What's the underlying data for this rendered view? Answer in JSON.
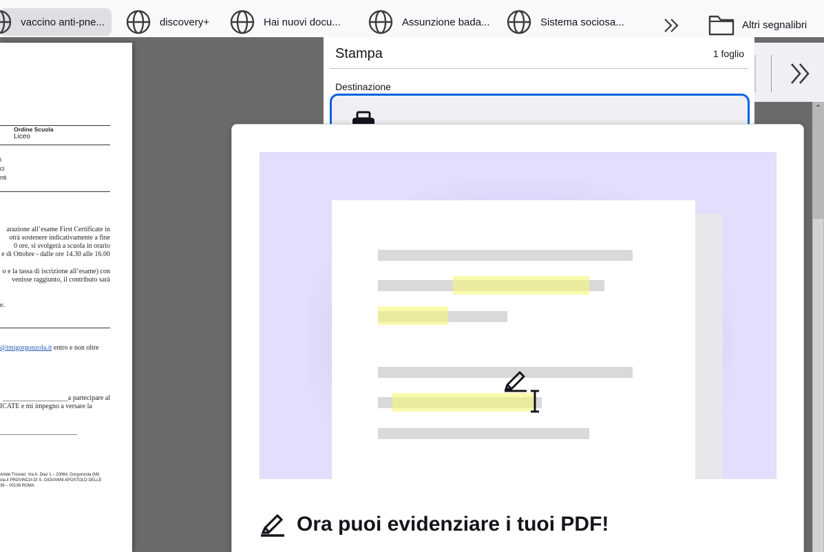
{
  "bookmarks": {
    "items": [
      {
        "label": "vaccino anti-pne...",
        "icon": "globe-icon"
      },
      {
        "label": "discovery+",
        "icon": "globe-icon"
      },
      {
        "label": "Hai nuovi docu...",
        "icon": "globe-icon"
      },
      {
        "label": "Assunzione bada...",
        "icon": "globe-icon"
      },
      {
        "label": "Sistema sociosa...",
        "icon": "globe-icon"
      }
    ],
    "overflow_icon": "chevron-double-right-icon",
    "other_label": "Altri segnalibri"
  },
  "pdf": {
    "ordine_label": "Ordine Scuola",
    "ordine_value": "Liceo",
    "lines_a": [
      "i",
      "ci",
      "nti"
    ],
    "para1": [
      "arazione all’esame First Certificate in",
      "otrà sostenere indicativamente a fine",
      "0 ore, si svolgerà a scuola in orario",
      "e di Ottobre - dalle ore 14.30 alle 16.00"
    ],
    "para2": [
      "o e la tassa di iscrizione all’esame) con",
      "venisse raggiunto, il contributo sarà"
    ],
    "para3": "e.",
    "email_link": "@imigorgonzola.it",
    "email_after": " entro e non oltre",
    "form1": "___________________a partecipare al",
    "form2": "ICATE e mi impegno a versare la",
    "form3": "________________________",
    "footer": [
      "Arilde Trouvet, Via A. Diaz 1 – 20064, Gorgonzola (MI)",
      "ola.it PROVINCIA DI S. GIOVANNI APOSTOLO DELLE",
      "36 – 00136 ROMA"
    ]
  },
  "print": {
    "title": "Stampa",
    "sheets": "1 foglio",
    "destination_label": "Destinazione",
    "printer_icon": "printer-icon"
  },
  "toolbar": {
    "overflow_icon": "chevron-double-right-icon"
  },
  "callout": {
    "title": "Ora puoi evidenziare i tuoi PDF!",
    "icon": "highlighter-icon",
    "illus_bg": "#e2defc",
    "highlight_color": "#f6f678"
  },
  "colors": {
    "accent": "#0061e0",
    "toolbar_bg": "#f9f9fb"
  }
}
